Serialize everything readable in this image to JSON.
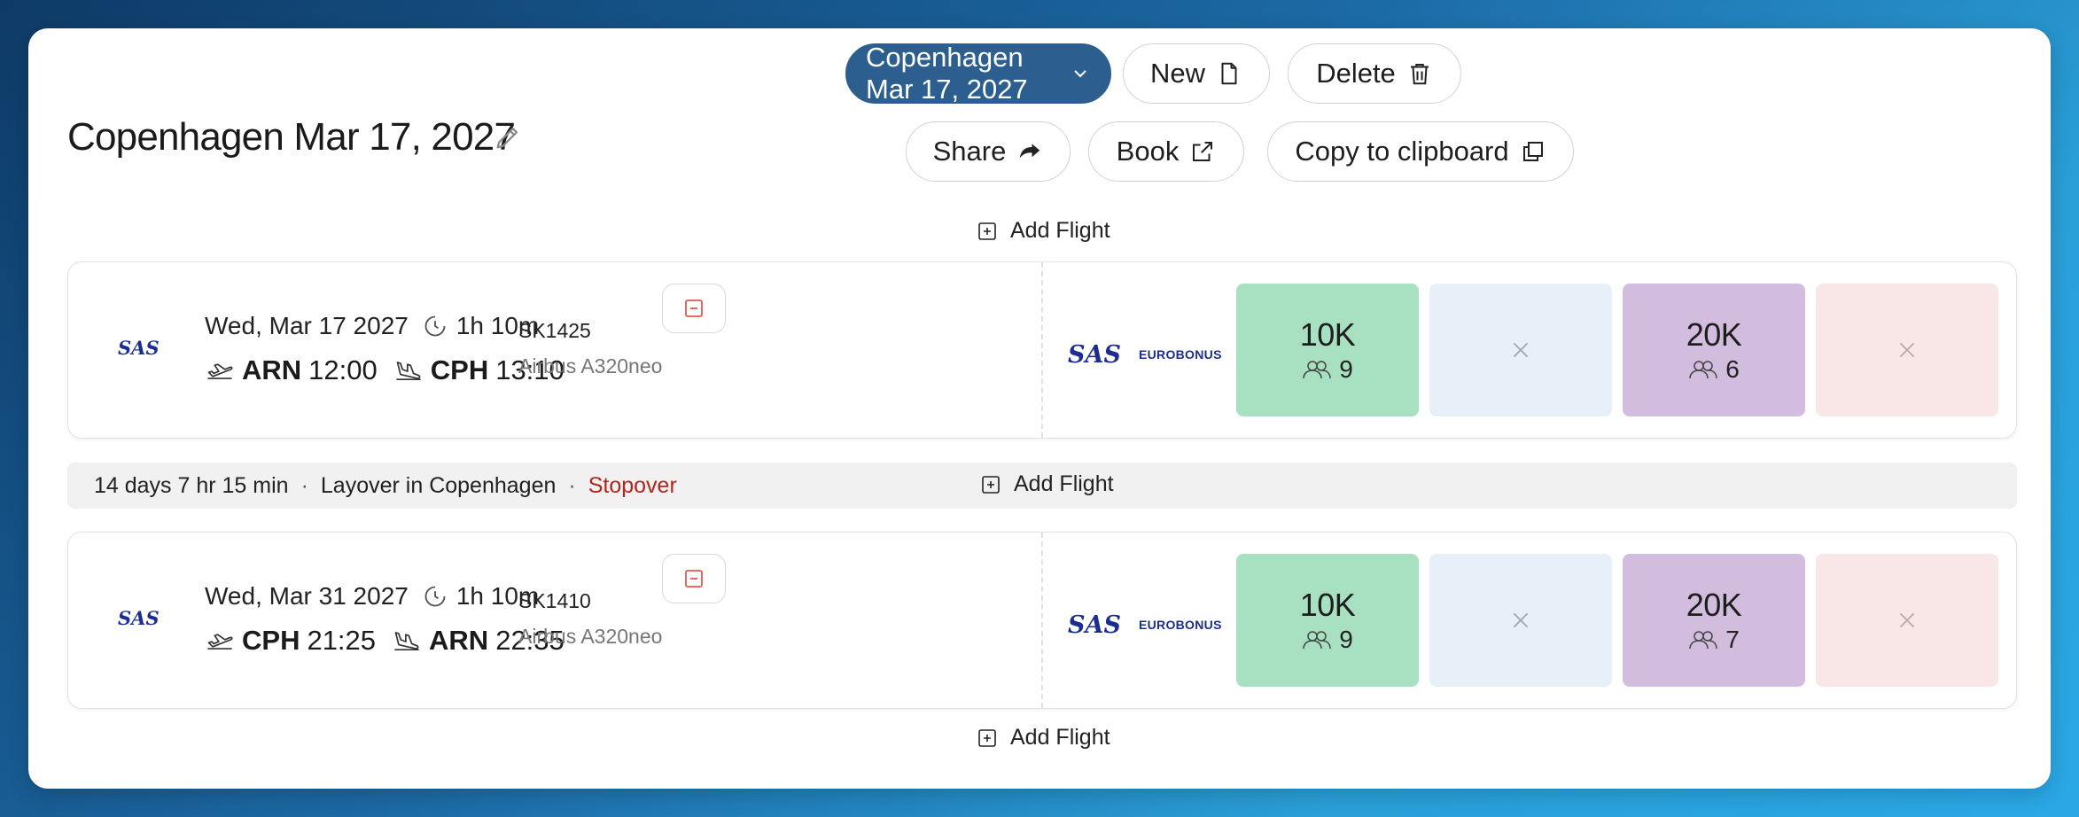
{
  "trip": {
    "title": "Copenhagen Mar 17, 2027"
  },
  "toolbar": {
    "trip_select": "Copenhagen Mar 17, 2027",
    "new_label": "New",
    "delete_label": "Delete",
    "share_label": "Share",
    "book_label": "Book",
    "copy_label": "Copy to clipboard"
  },
  "add_flight_label": "Add Flight",
  "flights": [
    {
      "date": "Wed, Mar 17 2027",
      "duration": "1h 10m",
      "dep_code": "ARN",
      "dep_time": "12:00",
      "arr_code": "CPH",
      "arr_time": "13:10",
      "flight_number": "SK1425",
      "aircraft": "Airbus A320neo",
      "fares": [
        {
          "points": "10K",
          "seats": "9",
          "available": true
        },
        {
          "available": false
        },
        {
          "points": "20K",
          "seats": "6",
          "available": true
        },
        {
          "available": false
        }
      ]
    },
    {
      "date": "Wed, Mar 31 2027",
      "duration": "1h 10m",
      "dep_code": "CPH",
      "dep_time": "21:25",
      "arr_code": "ARN",
      "arr_time": "22:35",
      "flight_number": "SK1410",
      "aircraft": "Airbus A320neo",
      "fares": [
        {
          "points": "10K",
          "seats": "9",
          "available": true
        },
        {
          "available": false
        },
        {
          "points": "20K",
          "seats": "7",
          "available": true
        },
        {
          "available": false
        }
      ]
    }
  ],
  "layover": {
    "duration": "14 days 7 hr 15 min",
    "location": "Layover in Copenhagen",
    "type": "Stopover"
  },
  "program": {
    "airline": "SAS",
    "loyalty": "EUROBONUS"
  },
  "colors": {
    "primary": "#2c5f8f",
    "fare_green": "#a8e0c2",
    "fare_blue": "#e7f0f8",
    "fare_purple": "#d3bddf",
    "fare_pink": "#f9e6e7",
    "stopover": "#b3261e",
    "sas_blue": "#1b2e8f"
  },
  "icons": [
    "pencil-icon",
    "chevron-down-icon",
    "file-icon",
    "trash-icon",
    "share-arrow-icon",
    "external-link-icon",
    "copy-icon",
    "plus-square-icon",
    "clock-icon",
    "takeoff-icon",
    "landing-icon",
    "minus-square-icon",
    "people-icon",
    "x-icon"
  ]
}
